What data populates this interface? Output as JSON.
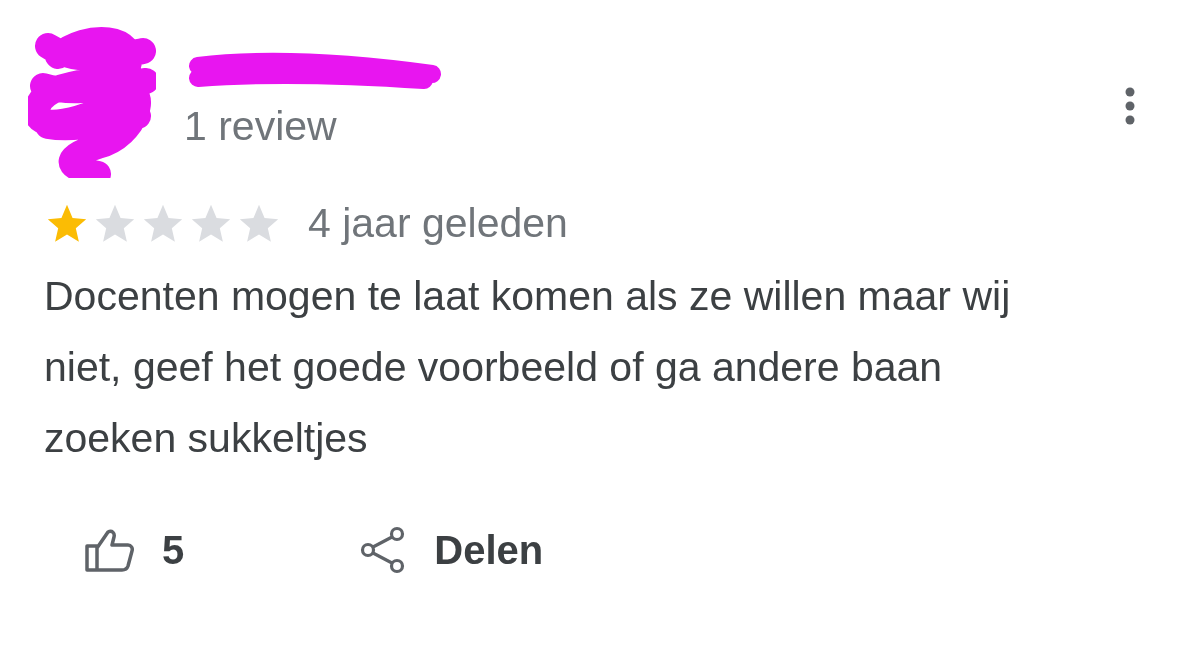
{
  "review": {
    "reviewer_reviews": "1 review",
    "stars": 1,
    "time": "4 jaar geleden",
    "text": "Docenten mogen te laat komen als ze willen maar wij niet, geef het goede voorbeeld of ga andere baan zoeken sukkeltjes",
    "likes": "5",
    "share_label": "Delen"
  }
}
